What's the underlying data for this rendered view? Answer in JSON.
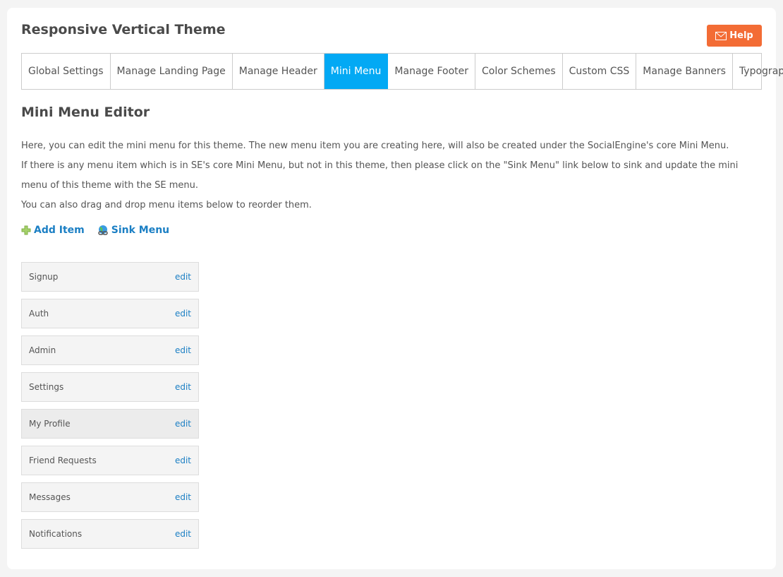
{
  "title": "Responsive Vertical Theme",
  "help": {
    "label": "Help",
    "icon": "mail-icon",
    "color": "#f36c35"
  },
  "tabs": [
    {
      "label": "Global Settings"
    },
    {
      "label": "Manage Landing Page"
    },
    {
      "label": "Manage Header"
    },
    {
      "label": "Mini Menu",
      "active": true
    },
    {
      "label": "Manage Footer"
    },
    {
      "label": "Color Schemes"
    },
    {
      "label": "Custom CSS"
    },
    {
      "label": "Manage Banners"
    },
    {
      "label": "Typography"
    }
  ],
  "accent": "#03a9f4",
  "section_title": "Mini Menu Editor",
  "description": [
    "Here, you can edit the mini menu for this theme. The new menu item you are creating here, will also be created under the SocialEngine's core Mini Menu.",
    "If there is any menu item which is in SE's core Mini Menu, but not in this theme, then please click on the \"Sink Menu\" link below to sink and update the mini menu of this theme with the SE menu.",
    "You can also drag and drop menu items below to reorder them."
  ],
  "actions": {
    "add_item": "Add Item",
    "sink_menu": "Sink Menu"
  },
  "edit_label": "edit",
  "menu_items": [
    {
      "label": "Signup"
    },
    {
      "label": "Auth"
    },
    {
      "label": "Admin"
    },
    {
      "label": "Settings"
    },
    {
      "label": "My Profile"
    },
    {
      "label": "Friend Requests"
    },
    {
      "label": "Messages"
    },
    {
      "label": "Notifications"
    }
  ]
}
